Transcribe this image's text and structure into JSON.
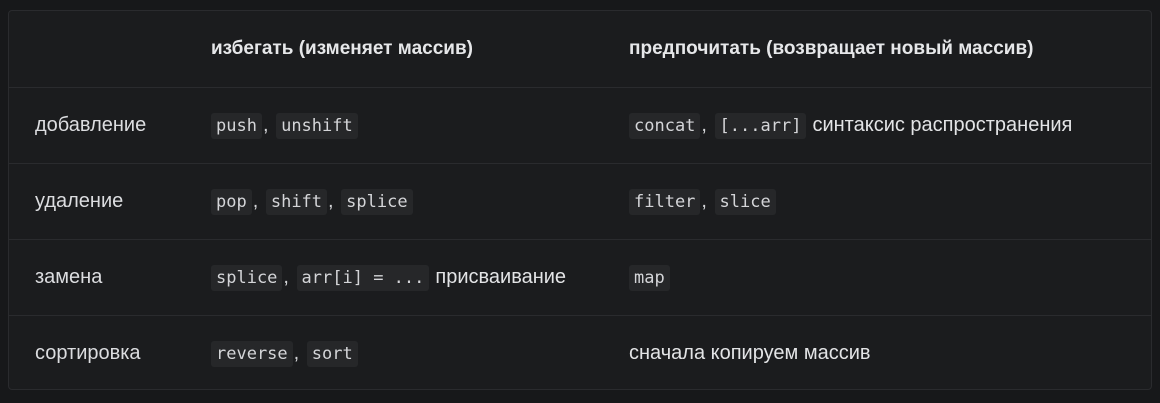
{
  "header": {
    "col1": "",
    "col2": "избегать (изменяет массив)",
    "col3": "предпочитать (возвращает новый массив)"
  },
  "rows": [
    {
      "label": "добавление",
      "avoid": {
        "codes": [
          "push",
          "unshift"
        ],
        "text": ""
      },
      "prefer": {
        "codes": [
          "concat",
          "[...arr]"
        ],
        "text": "синтаксис распространения"
      }
    },
    {
      "label": "удаление",
      "avoid": {
        "codes": [
          "pop",
          "shift",
          "splice"
        ],
        "text": ""
      },
      "prefer": {
        "codes": [
          "filter",
          "slice"
        ],
        "text": ""
      }
    },
    {
      "label": "замена",
      "avoid": {
        "codes": [
          "splice",
          "arr[i] = ..."
        ],
        "text": "присваивание"
      },
      "prefer": {
        "codes": [
          "map"
        ],
        "text": ""
      }
    },
    {
      "label": "сортировка",
      "avoid": {
        "codes": [
          "reverse",
          "sort"
        ],
        "text": ""
      },
      "prefer": {
        "codes": [],
        "text": "сначала копируем массив"
      }
    }
  ],
  "separator": ","
}
